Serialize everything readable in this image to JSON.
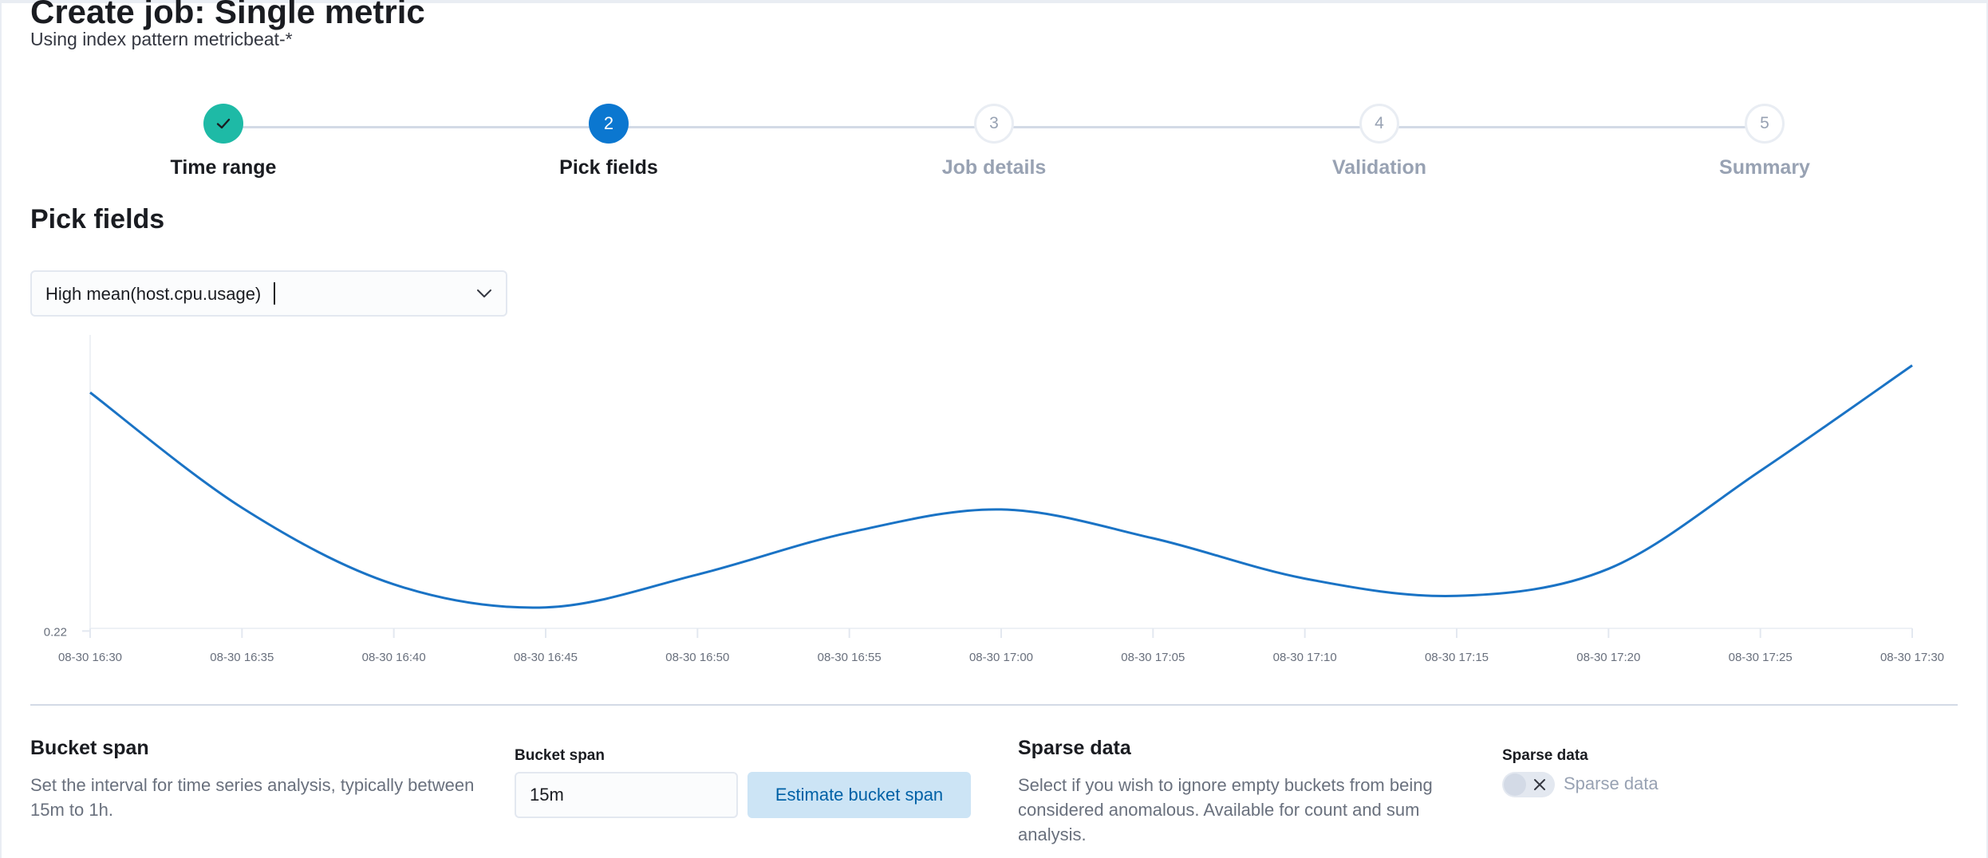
{
  "header": {
    "title": "Create job: Single metric",
    "subtitle": "Using index pattern metricbeat-*"
  },
  "steps": [
    {
      "number": "1",
      "label": "Time range",
      "state": "complete",
      "icon": "check-icon"
    },
    {
      "number": "2",
      "label": "Pick fields",
      "state": "current"
    },
    {
      "number": "3",
      "label": "Job details",
      "state": "incomplete"
    },
    {
      "number": "4",
      "label": "Validation",
      "state": "incomplete"
    },
    {
      "number": "5",
      "label": "Summary",
      "state": "incomplete"
    }
  ],
  "pick_fields": {
    "title": "Pick fields",
    "selected_field": "High mean(host.cpu.usage)",
    "dropdown_icon": "chevron-down-icon"
  },
  "chart_data": {
    "type": "line",
    "title": "",
    "xlabel": "",
    "ylabel": "",
    "y_tick_labels": [
      "0.22"
    ],
    "x_tick_labels": [
      "08-30 16:30",
      "08-30 16:35",
      "08-30 16:40",
      "08-30 16:45",
      "08-30 16:50",
      "08-30 16:55",
      "08-30 17:00",
      "08-30 17:05",
      "08-30 17:10",
      "08-30 17:15",
      "08-30 17:20",
      "08-30 17:25",
      "08-30 17:30"
    ],
    "series": [
      {
        "x": [
          "08-30 16:30",
          "08-30 16:35",
          "08-30 16:40",
          "08-30 16:45",
          "08-30 16:50",
          "08-30 16:55",
          "08-30 17:00",
          "08-30 17:05",
          "08-30 17:10",
          "08-30 17:15",
          "08-30 17:20",
          "08-30 17:25",
          "08-30 17:30"
        ],
        "values": [
          0.2614,
          0.2414,
          0.2281,
          0.2241,
          0.2298,
          0.2371,
          0.2411,
          0.2361,
          0.2291,
          0.2261,
          0.2308,
          0.2478,
          0.2661
        ],
        "color": "#1a73c5"
      }
    ],
    "ylim": [
      0.2206,
      0.2714
    ],
    "grid": false,
    "legend": "none"
  },
  "bucket_span": {
    "title": "Bucket span",
    "description": "Set the interval for time series analysis, typically between 15m to 1h.",
    "field_label": "Bucket span",
    "value": "15m",
    "estimate_button": "Estimate bucket span"
  },
  "sparse_data": {
    "title": "Sparse data",
    "description": "Select if you wish to ignore empty buckets from being considered anomalous. Available for count and sum analysis.",
    "field_label": "Sparse data",
    "toggle_label": "Sparse data",
    "enabled": false,
    "toggle_icon": "close-icon"
  },
  "colors": {
    "accent": "#0b77d0",
    "success": "#1ebaa6",
    "muted": "#98a2b3",
    "button_bg": "#cce4f5",
    "button_text": "#0061a6"
  }
}
